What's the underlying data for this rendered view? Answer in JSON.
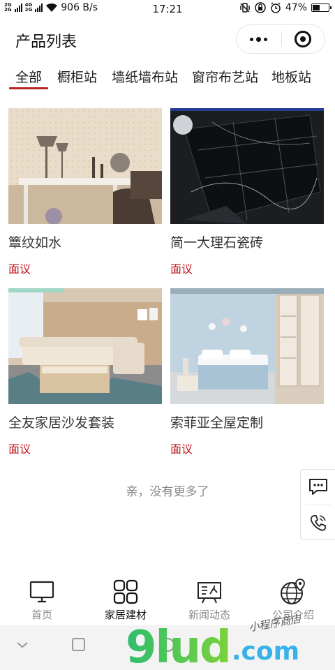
{
  "status_bar": {
    "network_top": "2G",
    "network_bottom": "2G",
    "network_4g": "4G",
    "speed": "906 B/s",
    "time": "17:21",
    "battery": "47%"
  },
  "header": {
    "title": "产品列表"
  },
  "tabs": [
    {
      "label": "全部",
      "active": true
    },
    {
      "label": "橱柜站"
    },
    {
      "label": "墙纸墙布站"
    },
    {
      "label": "窗帘布艺站"
    },
    {
      "label": "地板站"
    }
  ],
  "products": [
    {
      "name": "簟纹如水",
      "price": "面议"
    },
    {
      "name": "简一大理石瓷砖",
      "price": "面议"
    },
    {
      "name": "全友家居沙发套装",
      "price": "面议"
    },
    {
      "name": "索菲亚全屋定制",
      "price": "面议"
    }
  ],
  "list_end_text": "亲，没有更多了",
  "side_buttons": [
    {
      "icon": "chat-bubble-icon"
    },
    {
      "icon": "phone-icon"
    }
  ],
  "tab_bar": [
    {
      "label": "首页",
      "icon": "monitor-icon"
    },
    {
      "label": "家居建材",
      "icon": "grid-icon",
      "active": true
    },
    {
      "label": "新闻动态",
      "icon": "news-board-icon"
    },
    {
      "label": "公司介绍",
      "icon": "globe-pin-icon"
    }
  ],
  "watermark": {
    "main": "9lud",
    "domain": ".com",
    "tagline": "小程序商店"
  },
  "colors": {
    "accent_red": "#c0161d",
    "tab_underline": "#b8242a"
  }
}
